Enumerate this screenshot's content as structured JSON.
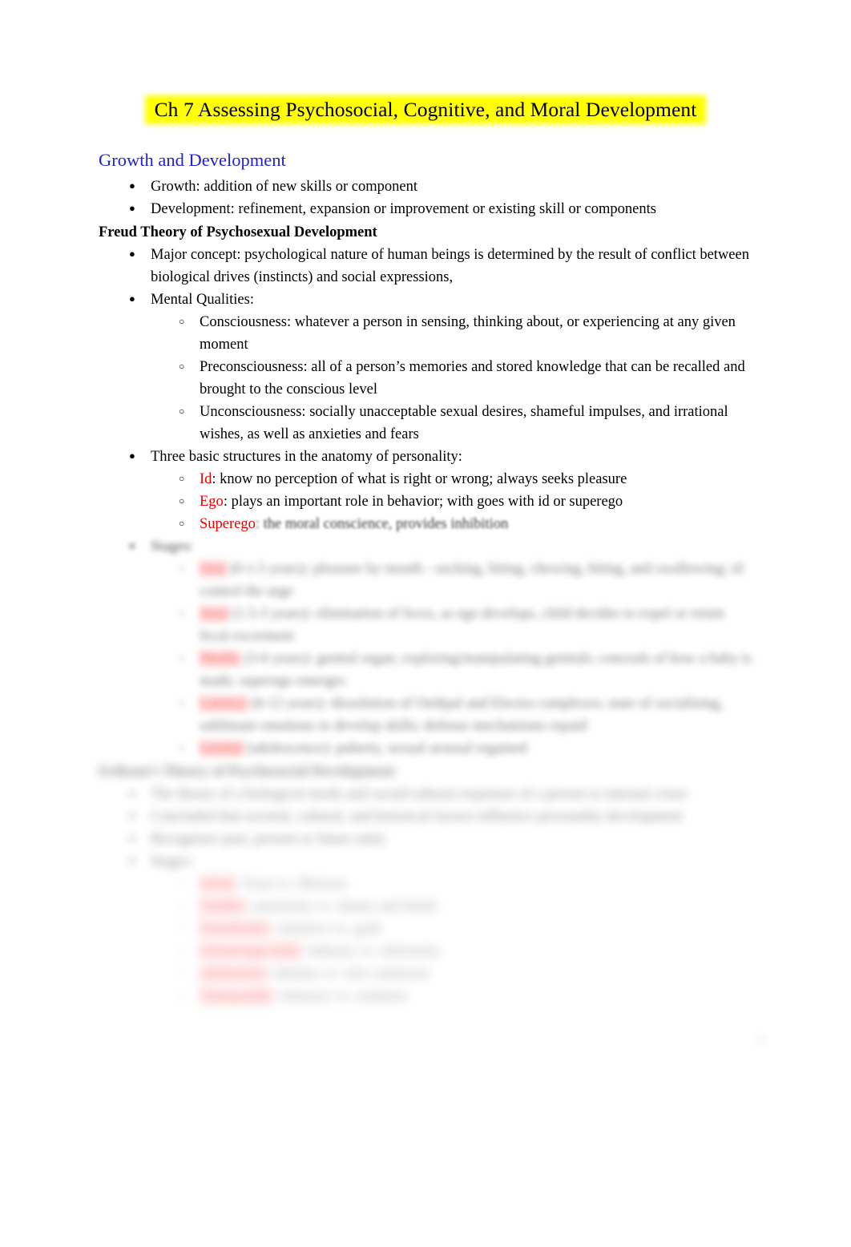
{
  "document": {
    "title": "Ch 7 Assessing Psychosocial, Cognitive, and Moral Development",
    "title_highlight_color": "#ffff00",
    "heading_color": "#2222cc",
    "term_color": "#ee0000",
    "page_number": "1"
  },
  "sections": [
    {
      "heading": "Growth and Development",
      "bullets": [
        "Growth: addition of new skills or component",
        "Development: refinement, expansion or improvement or existing skill or components"
      ]
    }
  ],
  "freud": {
    "heading": "Freud Theory of Psychosexual Development",
    "major_concept": "Major concept: psychological nature of human beings is determined by the result of conflict between biological drives (instincts) and social expressions,",
    "mental_qualities_label": "Mental Qualities:",
    "mental_qualities": [
      "Consciousness: whatever a person in sensing, thinking about, or experiencing at any given moment",
      "Preconsciousness: all of a person’s memories and stored knowledge that can be recalled and brought to the conscious level",
      "Unconsciousness: socially unacceptable sexual desires, shameful impulses, and irrational wishes, as well as anxieties and fears"
    ],
    "structures_label": "Three basic structures in the anatomy of personality:",
    "structures": [
      {
        "term": "Id",
        "text": ": know no perception of what is right or wrong; always seeks pleasure"
      },
      {
        "term": "Ego",
        "text": ": plays an important role in behavior; with goes with id or superego"
      },
      {
        "term": "Superego",
        "text": ": the moral conscience, provides inhibition"
      }
    ],
    "stages_label": "Stages:",
    "stages": [
      {
        "term": "Oral",
        "text": " (0-1.5 years): pleasure by mouth - sucking, biting, chewing, biting, and swallowing; id control the urge"
      },
      {
        "term": "Anal",
        "text": " (1.5-3 years): elimination of feces, as ego develops, child decides to expel or retain fecal excrement"
      },
      {
        "term": "Phallic",
        "text": " (3-6 years): genital organ; exploring/manipulating genitals; conceals of how a baby is made; superego emerges"
      },
      {
        "term": "Latency",
        "text": " (6-12 years): dissolution of Oedipal and Electra complexes; state of socializing, sublimate emotions to develop skills; defense mechanisms repaid"
      },
      {
        "term": "Genital",
        "text": " (adolescence): puberty, sexual arousal regained"
      }
    ]
  },
  "erikson": {
    "heading": "Erikson’s Theory of Psychosocial Development",
    "bullets": [
      "The theory of a biological needs and social/cultural responses of a person to internal crises",
      "Concluded that societal, cultural, and historical factors influence personality development",
      "Recognizes past, present or future unity",
      "Stages:"
    ],
    "stages": [
      {
        "term": "Infant",
        "text": ": Trust vs. Mistrust"
      },
      {
        "term": "Toddler",
        "text": ": autonomy vs. shame and doubt"
      },
      {
        "term": "Preschooler",
        "text": ": initiative vs. guilt"
      },
      {
        "term": "School-age child",
        "text": ": industry vs. inferiority"
      },
      {
        "term": "Adolescent",
        "text": ": identity vs. role confusion"
      },
      {
        "term": "Young adult",
        "text": ": intimacy vs. isolation"
      }
    ]
  }
}
